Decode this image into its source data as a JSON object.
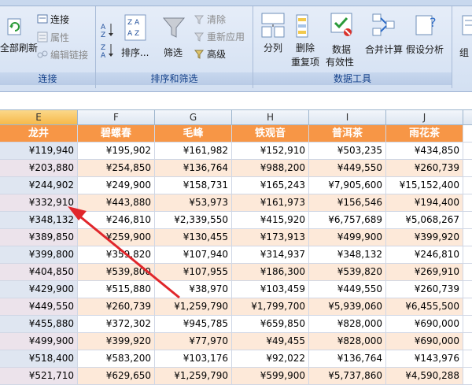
{
  "ribbon": {
    "groups": {
      "connections": {
        "label": "连接",
        "refresh_all": "全部刷新",
        "connections": "连接",
        "properties": "属性",
        "edit_links": "编辑链接"
      },
      "sort_filter": {
        "label": "排序和筛选",
        "sort": "排序...",
        "filter": "筛选",
        "clear": "清除",
        "reapply": "重新应用",
        "advanced": "高级"
      },
      "data_tools": {
        "label": "数据工具",
        "text_to_columns": "分列",
        "remove_dup_1": "删除",
        "remove_dup_2": "重复项",
        "validation_1": "数据",
        "validation_2": "有效性",
        "consolidate": "合并计算",
        "what_if": "假设分析"
      },
      "outline": {
        "label_partial": "组"
      }
    }
  },
  "sheet": {
    "columns": [
      "E",
      "F",
      "G",
      "H",
      "I",
      "J"
    ],
    "selected_column": "E",
    "headers": [
      "龙井",
      "碧螺春",
      "毛峰",
      "铁观音",
      "普洱茶",
      "雨花茶"
    ],
    "rows": [
      [
        "¥119,940",
        "¥195,902",
        "¥161,982",
        "¥152,910",
        "¥503,235",
        "¥434,850"
      ],
      [
        "¥203,880",
        "¥254,850",
        "¥136,764",
        "¥988,200",
        "¥449,550",
        "¥260,739"
      ],
      [
        "¥244,902",
        "¥249,900",
        "¥158,731",
        "¥165,243",
        "¥7,905,600",
        "¥15,152,400"
      ],
      [
        "¥332,910",
        "¥443,880",
        "¥53,973",
        "¥161,973",
        "¥156,546",
        "¥194,400"
      ],
      [
        "¥348,132",
        "¥246,810",
        "¥2,339,550",
        "¥415,920",
        "¥6,757,689",
        "¥5,068,267"
      ],
      [
        "¥389,850",
        "¥259,900",
        "¥130,455",
        "¥173,913",
        "¥499,900",
        "¥399,920"
      ],
      [
        "¥399,800",
        "¥359,820",
        "¥107,940",
        "¥314,937",
        "¥348,132",
        "¥246,810"
      ],
      [
        "¥404,850",
        "¥539,800",
        "¥107,955",
        "¥186,300",
        "¥539,820",
        "¥269,910"
      ],
      [
        "¥429,900",
        "¥515,880",
        "¥38,970",
        "¥103,459",
        "¥449,550",
        "¥260,739"
      ],
      [
        "¥449,550",
        "¥260,739",
        "¥1,259,790",
        "¥1,799,700",
        "¥5,939,060",
        "¥6,455,500"
      ],
      [
        "¥455,880",
        "¥372,302",
        "¥945,785",
        "¥659,850",
        "¥828,000",
        "¥690,000"
      ],
      [
        "¥499,900",
        "¥399,920",
        "¥77,970",
        "¥49,455",
        "¥828,000",
        "¥690,000"
      ],
      [
        "¥518,400",
        "¥583,200",
        "¥103,176",
        "¥92,022",
        "¥136,764",
        "¥143,976"
      ],
      [
        "¥521,710",
        "¥629,650",
        "¥1,259,790",
        "¥599,900",
        "¥5,737,860",
        "¥4,590,288"
      ]
    ]
  },
  "annotation": {
    "arrow_color": "#e0262b"
  },
  "colors": {
    "header_orange": "#f79646",
    "band": "#fde9d9",
    "ribbon_text": "#15428b"
  }
}
